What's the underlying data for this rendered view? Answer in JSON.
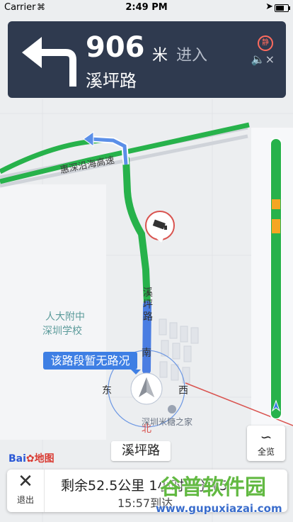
{
  "status_bar": {
    "carrier": "Carrier",
    "time": "2:49 PM"
  },
  "navigation": {
    "distance": "906",
    "unit": "米",
    "action": "进入",
    "road": "溪坪路",
    "badge": "静",
    "turn": "turn-left-arrow-icon",
    "mute": "speaker-mute-icon"
  },
  "map": {
    "highway_label": "惠深沿海高速",
    "school_line1": "人大附中",
    "school_line2": "深圳学校",
    "route_road_label": "溪坪路",
    "poi": "深圳米糖之家",
    "compass": {
      "north": "北",
      "south": "南",
      "east": "东",
      "west": "西"
    },
    "traffic_notice": "该路段暂无路况",
    "current_road": "溪坪路",
    "camera": "speed-camera-icon"
  },
  "overview_button": {
    "label": "全览",
    "icon": "route-overview-icon"
  },
  "logo": {
    "text_a": "Bai",
    "text_b": "地图"
  },
  "bottom_bar": {
    "exit_label": "退出",
    "remaining": "剩余52.5公里 1小时7分 ¥5",
    "eta": "15:57到达"
  },
  "watermark": {
    "brand": "谷普软件园",
    "url": "www.gupuxiazai.com"
  },
  "colors": {
    "route_green": "#27b24b",
    "route_blue": "#4a7de2",
    "nav_panel": "#2f3a4f",
    "progress_orange": "#f5a623"
  }
}
